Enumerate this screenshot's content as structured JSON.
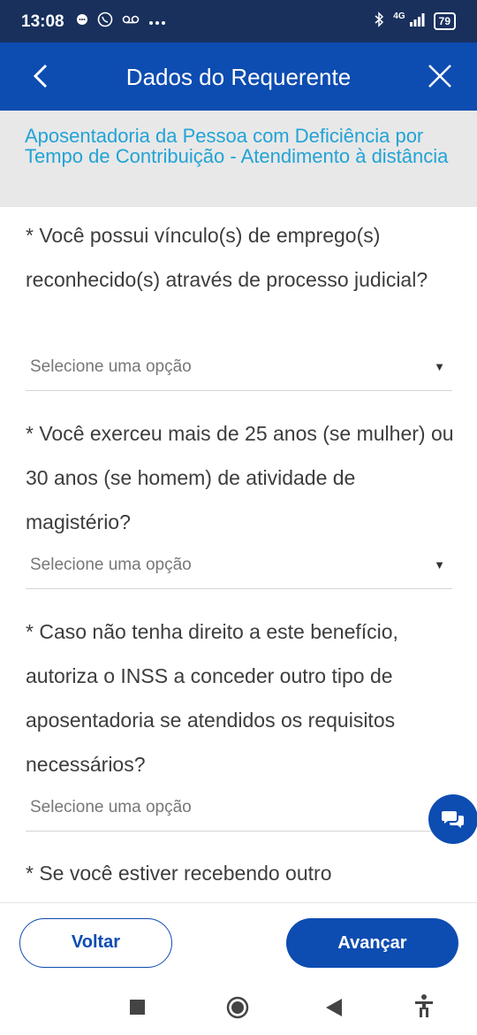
{
  "status_bar": {
    "time": "13:08",
    "network": "4G",
    "battery": "79",
    "left_icons": [
      "chat-bubble-icon",
      "whatsapp-icon",
      "voicemail-icon",
      "more-dots-icon"
    ],
    "right_icons": [
      "bluetooth-icon",
      "signal-icon",
      "battery-icon"
    ]
  },
  "app_bar": {
    "title": "Dados do Requerente",
    "back_icon": "chevron-left-icon",
    "close_icon": "close-icon"
  },
  "banner": {
    "text": "Aposentadoria da Pessoa com Deficiência por Tempo de Contribuição - Atendimento à distância"
  },
  "form": {
    "questions": [
      {
        "label": "* Você possui vínculo(s) de emprego(s) reconhecido(s) através de processo judicial?",
        "placeholder": "Selecione uma opção"
      },
      {
        "label": "* Você exerceu mais de 25 anos (se mulher) ou 30 anos (se homem) de atividade de magistério?",
        "placeholder": "Selecione uma opção"
      },
      {
        "label": "* Caso não tenha direito a este benefício, autoriza o INSS a conceder outro tipo de aposentadoria se atendidos os requisitos necessários?",
        "placeholder": "Selecione uma opção"
      },
      {
        "label": "* Se você estiver recebendo outro"
      }
    ]
  },
  "buttons": {
    "back_label": "Voltar",
    "next_label": "Avançar"
  },
  "colors": {
    "status_bar": "#19305d",
    "primary": "#0d4cb1",
    "banner_bg": "#e8e8e8",
    "banner_text": "#22a3d6"
  }
}
